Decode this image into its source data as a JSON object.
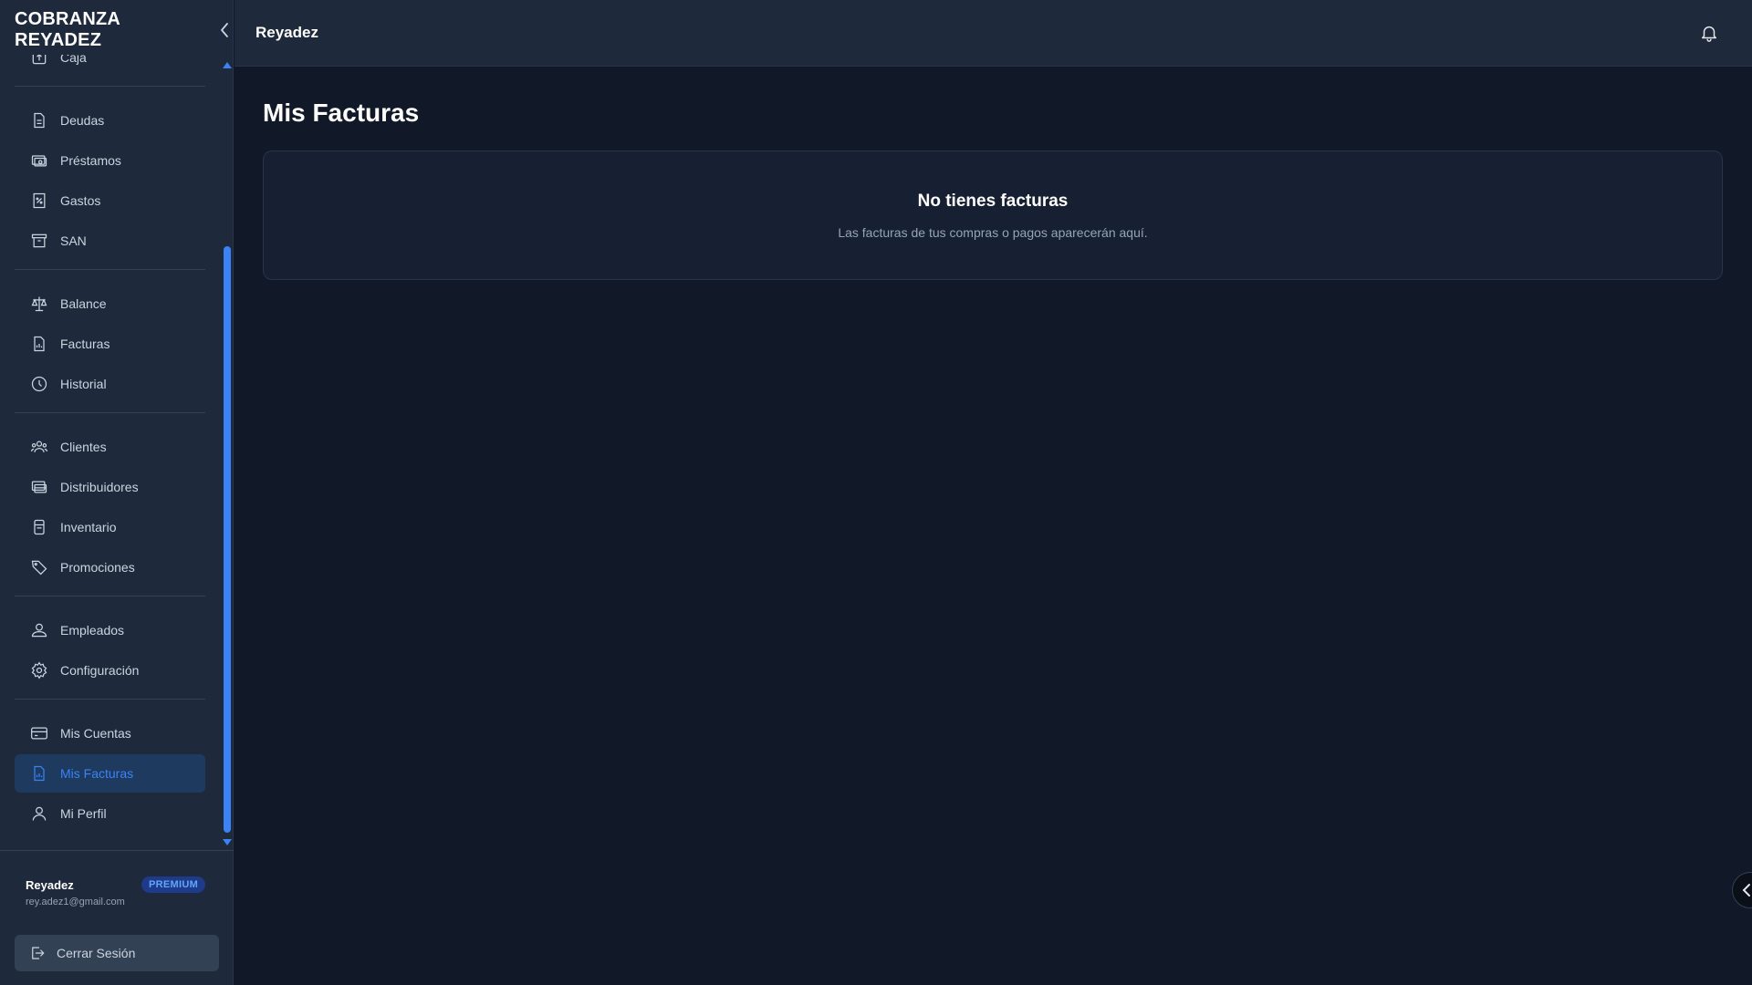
{
  "sidebar": {
    "brand": "COBRANZA REYADEZ",
    "items": [
      {
        "label": "Caja",
        "icon": "cash-register-icon"
      },
      {
        "label": "Deudas",
        "icon": "document-icon"
      },
      {
        "label": "Préstamos",
        "icon": "money-icon"
      },
      {
        "label": "Gastos",
        "icon": "receipt-percent-icon"
      },
      {
        "label": "SAN",
        "icon": "archive-box-icon"
      },
      {
        "label": "Balance",
        "icon": "scale-icon"
      },
      {
        "label": "Facturas",
        "icon": "document-chart-icon"
      },
      {
        "label": "Historial",
        "icon": "clock-icon"
      },
      {
        "label": "Clientes",
        "icon": "users-icon"
      },
      {
        "label": "Distribuidores",
        "icon": "truck-card-icon"
      },
      {
        "label": "Inventario",
        "icon": "clipboard-icon"
      },
      {
        "label": "Promociones",
        "icon": "tag-icon"
      },
      {
        "label": "Empleados",
        "icon": "user-group-icon"
      },
      {
        "label": "Configuración",
        "icon": "gear-icon"
      },
      {
        "label": "Mis Cuentas",
        "icon": "credit-card-icon"
      },
      {
        "label": "Mis Facturas",
        "icon": "document-chart-icon",
        "active": true
      },
      {
        "label": "Mi Perfil",
        "icon": "user-icon"
      }
    ],
    "user": {
      "name": "Reyadez",
      "email": "rey.adez1@gmail.com",
      "badge": "PREMIUM"
    },
    "logout_label": "Cerrar Sesión"
  },
  "header": {
    "title": "Reyadez"
  },
  "main": {
    "title": "Mis Facturas",
    "empty_title": "No tienes facturas",
    "empty_subtitle": "Las facturas de tus compras o pagos aparecerán aquí."
  },
  "colors": {
    "accent": "#3b82f6",
    "background": "#111827",
    "panel": "#1e293b"
  }
}
